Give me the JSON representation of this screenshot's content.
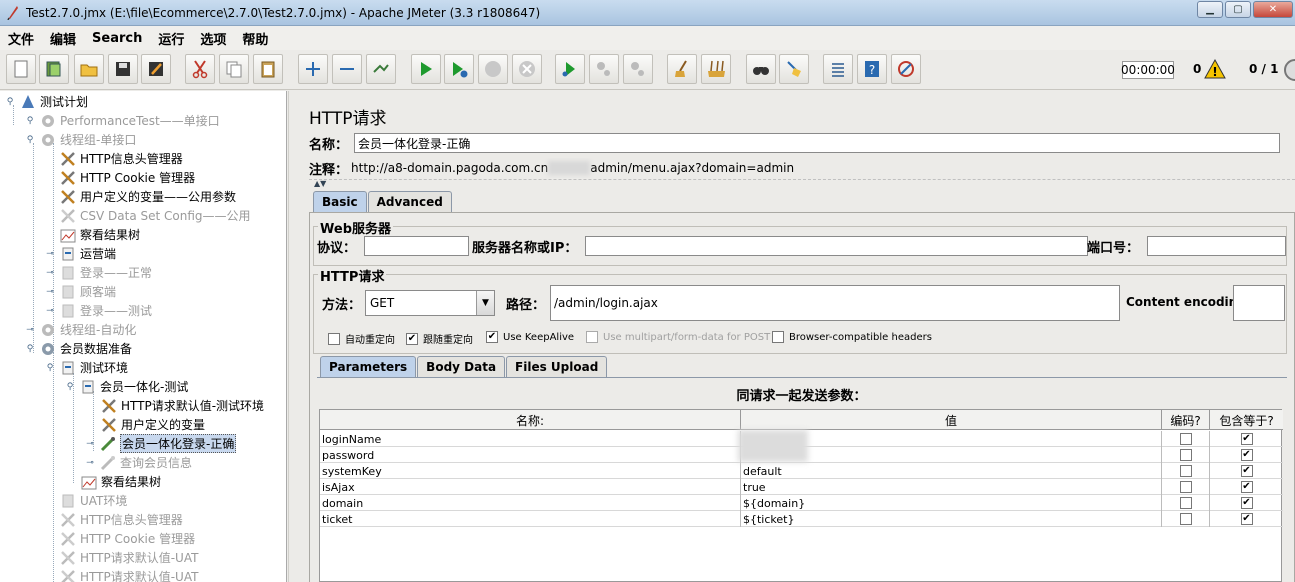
{
  "window": {
    "title": "Test2.7.0.jmx (E:\\file\\Ecommerce\\2.7.0\\Test2.7.0.jmx) - Apache JMeter (3.3 r1808647)",
    "minimize": "▁",
    "maximize": "▢",
    "close": "✕"
  },
  "menu": [
    "文件",
    "编辑",
    "Search",
    "运行",
    "选项",
    "帮助"
  ],
  "toolbar": {
    "timer": "00:00:00",
    "error_count": "0",
    "threads": "0 / 1"
  },
  "tree": {
    "items": [
      {
        "label": "测试计划",
        "icon": "test-plan-icon",
        "disabled": false
      },
      {
        "label": "PerformanceTest——单接口",
        "icon": "gear-icon",
        "disabled": true
      },
      {
        "label": "线程组-单接口",
        "icon": "gear-icon",
        "disabled": true
      },
      {
        "label": "HTTP信息头管理器",
        "icon": "wrench-icon",
        "disabled": false
      },
      {
        "label": "HTTP Cookie 管理器",
        "icon": "wrench-icon",
        "disabled": false
      },
      {
        "label": "用户定义的变量——公用参数",
        "icon": "wrench-icon",
        "disabled": false
      },
      {
        "label": "CSV Data Set Config——公用",
        "icon": "wrench-icon",
        "disabled": true
      },
      {
        "label": "察看结果树",
        "icon": "graph-icon",
        "disabled": false
      },
      {
        "label": "运营端",
        "icon": "controller-icon",
        "disabled": false
      },
      {
        "label": "登录——正常",
        "icon": "controller-icon",
        "disabled": true
      },
      {
        "label": "顾客端",
        "icon": "controller-icon",
        "disabled": true
      },
      {
        "label": "登录——测试",
        "icon": "controller-icon",
        "disabled": true
      },
      {
        "label": "线程组-自动化",
        "icon": "gear-icon",
        "disabled": true
      },
      {
        "label": "会员数据准备",
        "icon": "gear-icon",
        "disabled": false
      },
      {
        "label": "测试环境",
        "icon": "controller-icon",
        "disabled": false
      },
      {
        "label": "会员一体化-测试",
        "icon": "controller-icon",
        "disabled": false
      },
      {
        "label": "HTTP请求默认值-测试环境",
        "icon": "wrench-icon",
        "disabled": false
      },
      {
        "label": "用户定义的变量",
        "icon": "wrench-icon",
        "disabled": false
      },
      {
        "label": "会员一体化登录-正确",
        "icon": "pipette-icon",
        "disabled": false
      },
      {
        "label": "查询会员信息",
        "icon": "pipette-icon",
        "disabled": true
      },
      {
        "label": "察看结果树",
        "icon": "graph-icon",
        "disabled": false
      },
      {
        "label": "UAT环境",
        "icon": "controller-icon",
        "disabled": true
      },
      {
        "label": "HTTP信息头管理器",
        "icon": "wrench-icon",
        "disabled": true
      },
      {
        "label": "HTTP Cookie 管理器",
        "icon": "wrench-icon",
        "disabled": true
      },
      {
        "label": "HTTP请求默认值-UAT",
        "icon": "wrench-icon",
        "disabled": true
      },
      {
        "label": "HTTP请求默认值-UAT",
        "icon": "wrench-icon",
        "disabled": true
      }
    ]
  },
  "panel": {
    "title": "HTTP请求",
    "name_label": "名称：",
    "name_value": "会员一体化登录-正确",
    "comment_label": "注释：",
    "comment_value_a": "http://a8-domain.pagoda.com.cn",
    "comment_value_b": "admin/menu.ajax?domain=admin",
    "tabs": [
      "Basic",
      "Advanced"
    ]
  },
  "web_server": {
    "group_title": "Web服务器",
    "protocol_label": "协议：",
    "protocol_value": "",
    "server_label": "服务器名称或IP：",
    "server_value": "",
    "port_label": "端口号：",
    "port_value": ""
  },
  "http_request": {
    "group_title": "HTTP请求",
    "method_label": "方法：",
    "method_value": "GET",
    "path_label": "路径：",
    "path_value": "/admin/login.ajax",
    "encoding_label": "Content encoding:",
    "encoding_value": "",
    "options": [
      {
        "label": "自动重定向",
        "checked": false,
        "disabled": false
      },
      {
        "label": "跟随重定向",
        "checked": true,
        "disabled": false
      },
      {
        "label": "Use KeepAlive",
        "checked": true,
        "disabled": false
      },
      {
        "label": "Use multipart/form-data for POST",
        "checked": false,
        "disabled": true
      },
      {
        "label": "Browser-compatible headers",
        "checked": false,
        "disabled": false
      }
    ]
  },
  "params": {
    "tabs": [
      "Parameters",
      "Body Data",
      "Files Upload"
    ],
    "caption": "同请求一起发送参数：",
    "columns": [
      "名称:",
      "值",
      "编码?",
      "包含等于?"
    ],
    "rows": [
      {
        "name": "loginName",
        "value": "",
        "encode": false,
        "include_equals": true
      },
      {
        "name": "password",
        "value": "",
        "encode": false,
        "include_equals": true
      },
      {
        "name": "systemKey",
        "value": "default",
        "encode": false,
        "include_equals": true
      },
      {
        "name": "isAjax",
        "value": "true",
        "encode": false,
        "include_equals": true
      },
      {
        "name": "domain",
        "value": "${domain}",
        "encode": false,
        "include_equals": true
      },
      {
        "name": "ticket",
        "value": "${ticket}",
        "encode": false,
        "include_equals": true
      }
    ]
  }
}
